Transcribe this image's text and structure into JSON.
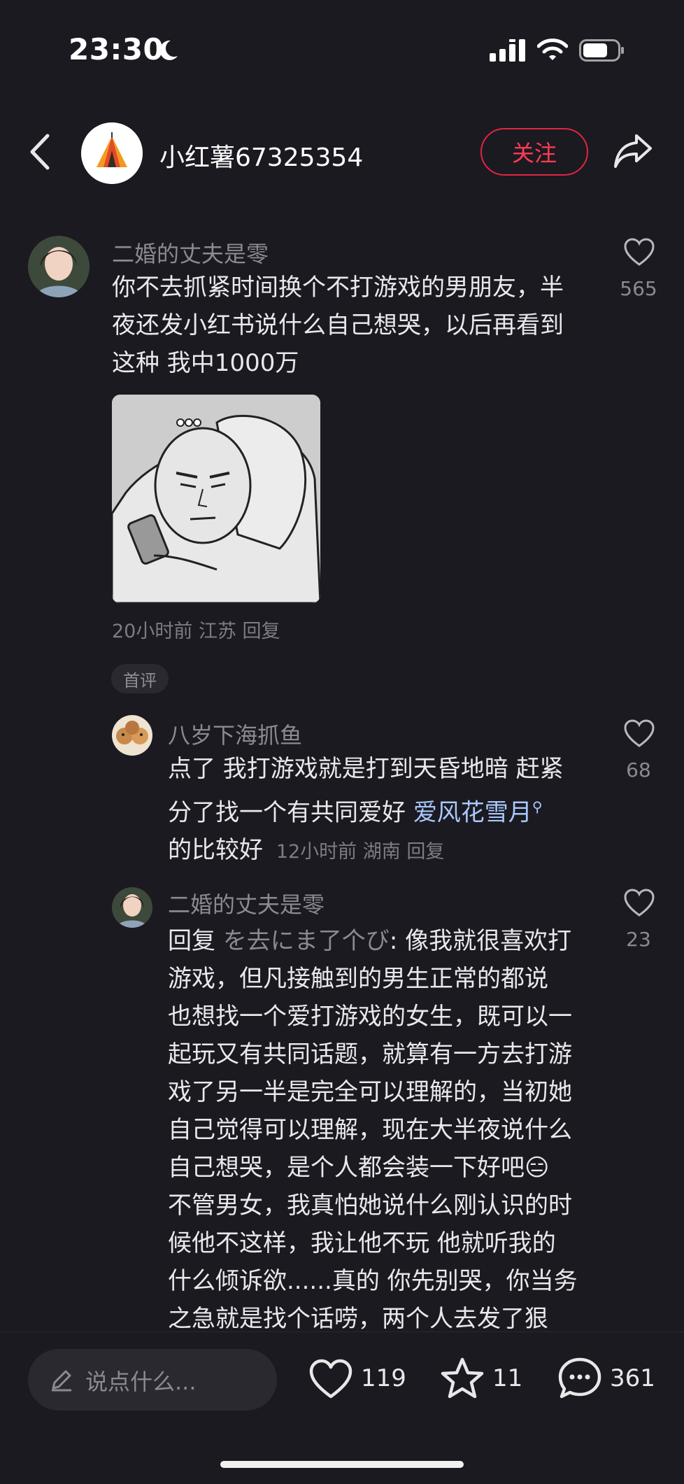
{
  "status": {
    "time": "23:30"
  },
  "header": {
    "author_name": "小红薯67325354",
    "follow_label": "关注"
  },
  "comments": [
    {
      "username": "二婚的丈夫是零",
      "lines": [
        "你不去抓紧时间换个不打游戏的男朋友，半",
        "夜还发小红书说什么自己想哭，以后再看到",
        "这种 我中1000万"
      ],
      "meta": "20小时前 江苏 回复",
      "likes": "565",
      "badge": "首评"
    }
  ],
  "replies": [
    {
      "username": "八岁下海抓鱼",
      "line1": "点了 我打游戏就是打到天昏地暗 赶紧",
      "line2_prefix": "分了找一个有共同爱好 ",
      "line2_link": "爱风花雪月",
      "line3": "的比较好",
      "meta": "12小时前 湖南 回复",
      "likes": "68"
    },
    {
      "username": "二婚的丈夫是零",
      "reply_prefix": "回复 ",
      "reply_target": "を去にま了个び",
      "lines": [
        ": 像我就很喜欢打",
        "游戏，但凡接触到的男生正常的都说",
        "也想找一个爱打游戏的女生，既可以一",
        "起玩又有共同话题，就算有一方去打游",
        "戏了另一半是完全可以理解的，当初她",
        "自己觉得可以理解，现在大半夜说什么",
        "自己想哭，是个人都会装一下好吧😑",
        "不管男女，我真怕她说什么刚认识的时",
        "候他不这样，我让他不玩 他就听我的",
        "什么倾诉欲......真的 你先别哭，你当务",
        "之急就是找个话唠，两个人去发了狠"
      ],
      "likes": "23"
    }
  ],
  "bottom": {
    "input_placeholder": "说点什么...",
    "like_count": "119",
    "star_count": "11",
    "comment_count": "361"
  }
}
